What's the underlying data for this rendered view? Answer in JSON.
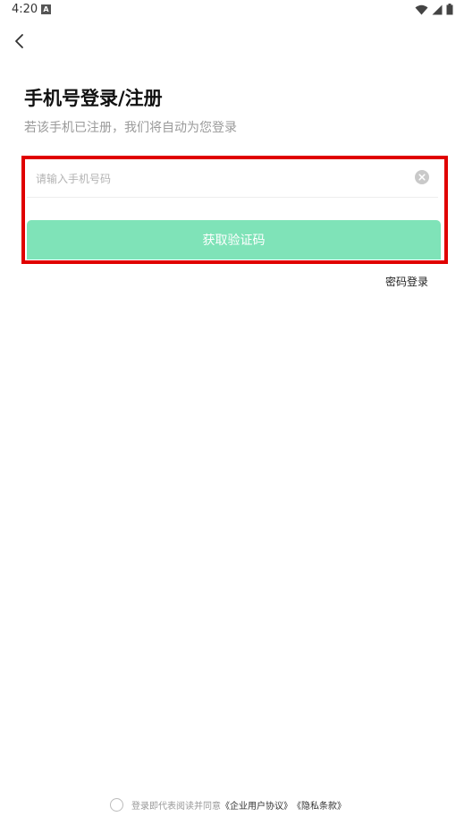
{
  "status_bar": {
    "time": "4:20",
    "notification_letter": "A"
  },
  "header": {
    "title": "手机号登录/注册",
    "subtitle": "若该手机已注册，我们将自动为您登录"
  },
  "form": {
    "phone_placeholder": "请输入手机号码",
    "phone_value": "",
    "get_code_label": "获取验证码",
    "button_color": "#7fe3b8",
    "highlight_color": "#e00000"
  },
  "alt_login": {
    "password_login_label": "密码登录"
  },
  "agreement": {
    "prefix": "登录即代表阅读并同意",
    "user_agreement": "《企业用户协议》",
    "privacy": "《隐私条款》"
  }
}
